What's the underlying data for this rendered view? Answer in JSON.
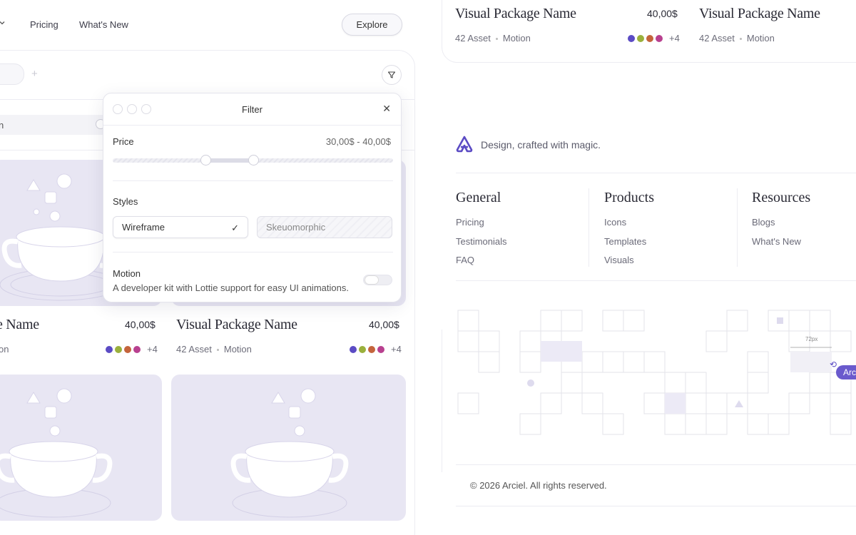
{
  "nav": {
    "links": [
      "Pricing",
      "What's New"
    ],
    "explore_label": "Explore"
  },
  "filter": {
    "title": "Filter",
    "price_label": "Price",
    "price_range": "30,00$ - 40,00$",
    "price_low_fraction": 0.33,
    "price_high_fraction": 0.5,
    "styles_label": "Styles",
    "style_selected": "Wireframe",
    "style_other": "Skeuomorphic",
    "motion_label": "Motion",
    "motion_desc": "A developer kit with Lottie support for easy UI animations.",
    "motion_enabled": false
  },
  "left_input_text": "n",
  "cards": [
    {
      "title": "e Name",
      "price": "40,00$",
      "meta_type": "on",
      "more": "+4"
    },
    {
      "title": "Visual Package Name",
      "price": "40,00$",
      "assets": "42 Asset",
      "meta_type": "Motion",
      "more": "+4"
    }
  ],
  "swatch_colors": [
    "#5b4bc4",
    "#9ab03c",
    "#c4643c",
    "#b8408f"
  ],
  "top_cards": [
    {
      "title": "Visual Package Name",
      "price": "40,00$",
      "assets": "42 Asset",
      "meta_type": "Motion",
      "more": "+4"
    },
    {
      "title": "Visual Package Name",
      "assets": "42 Asset",
      "meta_type": "Motion"
    }
  ],
  "footer": {
    "tagline": "Design, crafted with magic.",
    "columns": [
      {
        "heading": "General",
        "links": [
          "Pricing",
          "Testimonials",
          "FAQ"
        ]
      },
      {
        "heading": "Products",
        "links": [
          "Icons",
          "Templates",
          "Visuals"
        ]
      },
      {
        "heading": "Resources",
        "links": [
          "Blogs",
          "What's New"
        ]
      }
    ],
    "measure_label": "72px",
    "badge_label": "Arc",
    "copyright": "© 2026 Arciel. All rights reserved."
  },
  "accent": "#6a5acd"
}
